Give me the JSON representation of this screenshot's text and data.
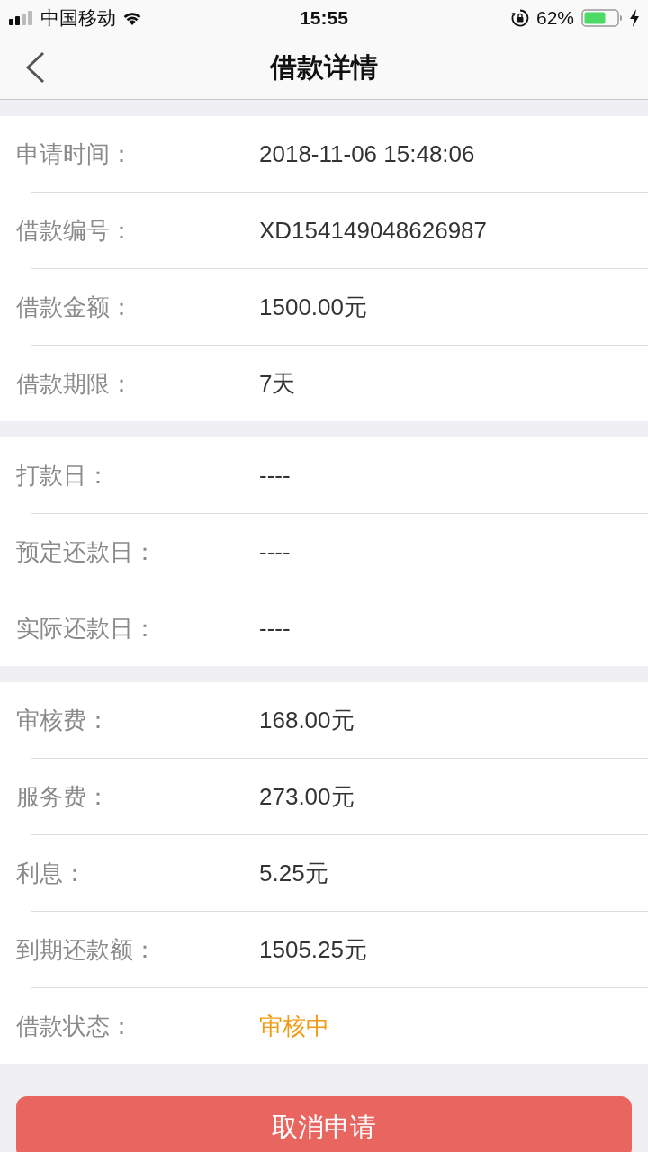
{
  "status_bar": {
    "carrier": "中国移动",
    "time": "15:55",
    "battery_percent": "62%"
  },
  "nav_bar": {
    "title": "借款详情"
  },
  "sections": [
    {
      "rows": [
        {
          "kind": "plain",
          "label": "申请时间：",
          "value": "2018-11-06 15:48:06"
        },
        {
          "kind": "plain",
          "label": "借款编号：",
          "value": "XD154149048626987"
        },
        {
          "kind": "plain",
          "label": "借款金额：",
          "value": "1500.00元"
        },
        {
          "kind": "plain",
          "label": "借款期限：",
          "value": "7天"
        }
      ]
    },
    {
      "rows": [
        {
          "kind": "plain",
          "label": "打款日：",
          "value": "----"
        },
        {
          "kind": "plain",
          "label": "预定还款日：",
          "value": "----"
        },
        {
          "kind": "plain",
          "label": "实际还款日：",
          "value": "----"
        }
      ]
    },
    {
      "rows": [
        {
          "kind": "plain",
          "label": "审核费：",
          "value": "168.00元"
        },
        {
          "kind": "plain",
          "label": "服务费：",
          "value": "273.00元"
        },
        {
          "kind": "plain",
          "label": "利息：",
          "value": "5.25元"
        },
        {
          "kind": "plain",
          "label": "到期还款额：",
          "value": "1505.25元"
        },
        {
          "kind": "status",
          "label": "借款状态：",
          "value": "审核中"
        }
      ]
    }
  ],
  "button": {
    "label": "取消申请"
  }
}
